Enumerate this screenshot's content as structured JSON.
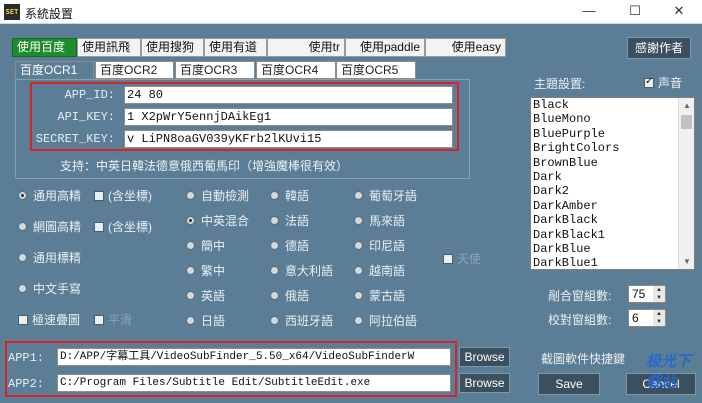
{
  "window": {
    "title": "系統設置",
    "icon_text": "SET",
    "minimize": "—",
    "maximize": "☐",
    "close": "✕"
  },
  "engine_tabs": [
    {
      "label": "使用百度"
    },
    {
      "label": "使用訊飛"
    },
    {
      "label": "使用搜狗"
    },
    {
      "label": "使用有道"
    },
    {
      "label": "使用tr"
    },
    {
      "label": "使用paddle"
    },
    {
      "label": "使用easy"
    }
  ],
  "thanks_button": "感謝作者",
  "ocr_tabs": [
    "百度OCR1",
    "百度OCR2",
    "百度OCR3",
    "百度OCR4",
    "百度OCR5"
  ],
  "credentials": {
    "app_id_label": "APP_ID:",
    "app_id_value": "24  80",
    "api_key_label": "API_KEY:",
    "api_key_value": "1  X2pWrY5ennjDAikEg1",
    "secret_key_label": "SECRET_KEY:",
    "secret_key_value": "v  LiPN8oaGV039yKFrb2lKUvi15"
  },
  "support_text": "支持：中英日韓法德意俄西葡馬印（增強魔棒很有效）",
  "recognition_modes": {
    "general_high": "通用高精",
    "with_coords_1": "(含坐標)",
    "web_high": "網圖高精",
    "with_coords_2": "(含坐標)",
    "general_std": "通用標精",
    "handwriting": "中文手寫",
    "fast_merge": "極速疊圖",
    "fast_merge_extra": "平滑"
  },
  "languages": [
    [
      "自動檢測",
      "韓語",
      "葡萄牙語"
    ],
    [
      "中英混合",
      "法語",
      "馬來語"
    ],
    [
      "簡中",
      "德語",
      "印尼語"
    ],
    [
      "繁中",
      "意大利語",
      "越南語"
    ],
    [
      "英語",
      "俄語",
      "蒙古語"
    ],
    [
      "日語",
      "西班牙語",
      "阿拉伯語"
    ]
  ],
  "extra_option": "天使",
  "theme": {
    "label": "主題設置:",
    "sound_label": "声音",
    "items": [
      "Black",
      "BlueMono",
      "BluePurple",
      "BrightColors",
      "BrownBlue",
      "Dark",
      "Dark2",
      "DarkAmber",
      "DarkBlack",
      "DarkBlack1",
      "DarkBlue",
      "DarkBlue1"
    ]
  },
  "window_groups": {
    "cut_label": "剮合窗組數:",
    "cut_value": "75",
    "proof_label": "校對窗組數:",
    "proof_value": "6"
  },
  "apps": {
    "app1_label": "APP1:",
    "app1_value": "D:/APP/字幕工具/VideoSubFinder_5.50_x64/VideoSubFinderW",
    "app2_label": "APP2:",
    "app2_value": "C:/Program Files/Subtitle Edit/SubtitleEdit.exe",
    "browse": "Browse"
  },
  "screenshot_hotkey_label": "截圖軟件快捷鍵",
  "save_button": "Save",
  "cancel_button": "Cancel",
  "watermark": "极光下载站",
  "colors": {
    "active_tab": "#1e8c2c",
    "highlight_box": "#d4242a",
    "background": "#5b7d95"
  }
}
